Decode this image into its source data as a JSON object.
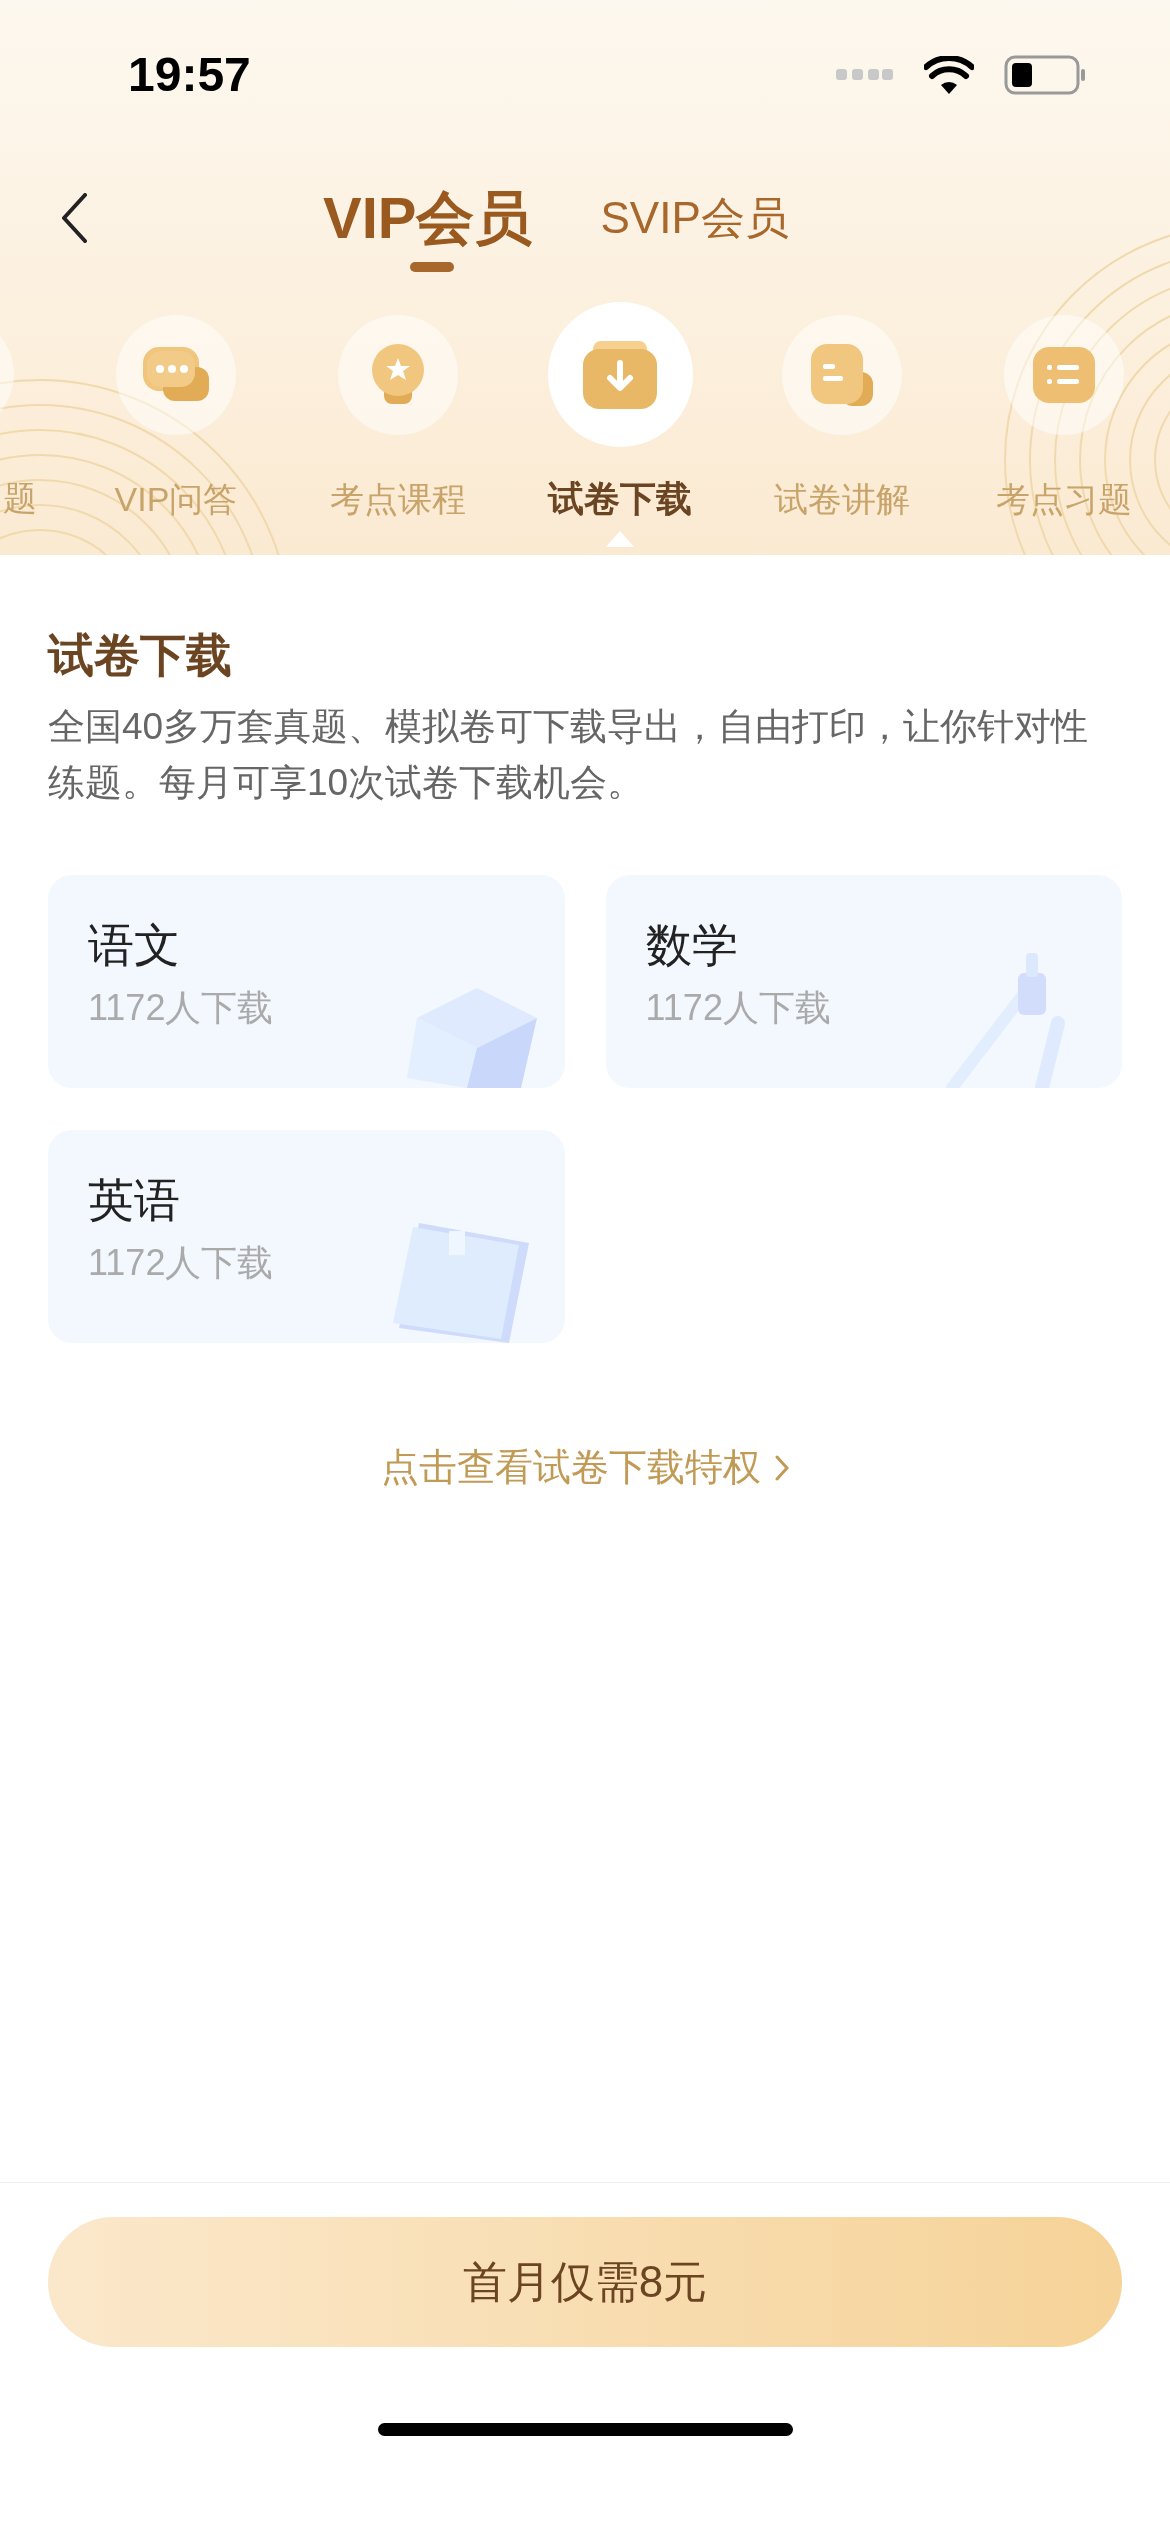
{
  "status_bar": {
    "time": "19:57"
  },
  "nav": {
    "tabs": [
      {
        "label": "VIP会员",
        "selected": true
      },
      {
        "label": "SVIP会员",
        "selected": false
      }
    ]
  },
  "features": [
    {
      "label": "题",
      "selected": false
    },
    {
      "label": "VIP问答",
      "selected": false
    },
    {
      "label": "考点课程",
      "selected": false
    },
    {
      "label": "试卷下载",
      "selected": true
    },
    {
      "label": "试卷讲解",
      "selected": false
    },
    {
      "label": "考点习题",
      "selected": false
    }
  ],
  "section": {
    "title": "试卷下载",
    "description": "全国40多万套真题、模拟卷可下载导出，自由打印，让你针对性练题。每月可享10次试卷下载机会。",
    "subjects": [
      {
        "name": "语文",
        "count": "1172人下载"
      },
      {
        "name": "数学",
        "count": "1172人下载"
      },
      {
        "name": "英语",
        "count": "1172人下载"
      }
    ],
    "link": "点击查看试卷下载特权"
  },
  "cta": {
    "label": "首月仅需8元"
  }
}
